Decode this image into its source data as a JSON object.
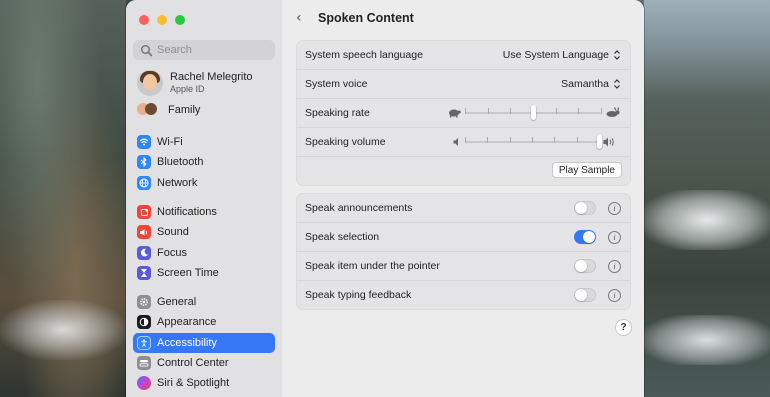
{
  "window": {
    "title": "Spoken Content"
  },
  "sidebar": {
    "search_placeholder": "Search",
    "profile": {
      "name": "Rachel Melegrito",
      "subtitle": "Apple ID"
    },
    "family_label": "Family",
    "groups": [
      [
        {
          "label": "Wi-Fi",
          "icon": "wifi-icon",
          "color": "#2f86f6"
        },
        {
          "label": "Bluetooth",
          "icon": "bluetooth-icon",
          "color": "#2f86f6"
        },
        {
          "label": "Network",
          "icon": "globe-icon",
          "color": "#2f86f6"
        }
      ],
      [
        {
          "label": "Notifications",
          "icon": "bell-icon",
          "color": "#f0453a"
        },
        {
          "label": "Sound",
          "icon": "speaker-icon",
          "color": "#f0453a"
        },
        {
          "label": "Focus",
          "icon": "moon-icon",
          "color": "#5b5ad8"
        },
        {
          "label": "Screen Time",
          "icon": "hourglass-icon",
          "color": "#5b5ad8"
        }
      ],
      [
        {
          "label": "General",
          "icon": "gear-icon",
          "color": "#8e8e93"
        },
        {
          "label": "Appearance",
          "icon": "appearance-icon",
          "color": "#1c1c1e"
        },
        {
          "label": "Accessibility",
          "icon": "accessibility-icon",
          "color": "#2f86f6",
          "active": true
        },
        {
          "label": "Control Center",
          "icon": "control-center-icon",
          "color": "#8e8e93"
        },
        {
          "label": "Siri & Spotlight",
          "icon": "siri-icon",
          "color": "#c443d6"
        }
      ]
    ]
  },
  "main": {
    "system_speech_language": {
      "label": "System speech language",
      "value": "Use System Language"
    },
    "system_voice": {
      "label": "System voice",
      "value": "Samantha"
    },
    "speaking_rate": {
      "label": "Speaking rate",
      "value_fraction": 0.5
    },
    "speaking_volume": {
      "label": "Speaking volume",
      "value_fraction": 1.0
    },
    "play_sample_label": "Play Sample",
    "toggles": [
      {
        "label": "Speak announcements",
        "on": false
      },
      {
        "label": "Speak selection",
        "on": true
      },
      {
        "label": "Speak item under the pointer",
        "on": false
      },
      {
        "label": "Speak typing feedback",
        "on": false
      }
    ],
    "info_glyph": "i",
    "help_glyph": "?"
  },
  "colors": {
    "accent": "#3478f6",
    "toggle_off": "#d9d9db"
  }
}
